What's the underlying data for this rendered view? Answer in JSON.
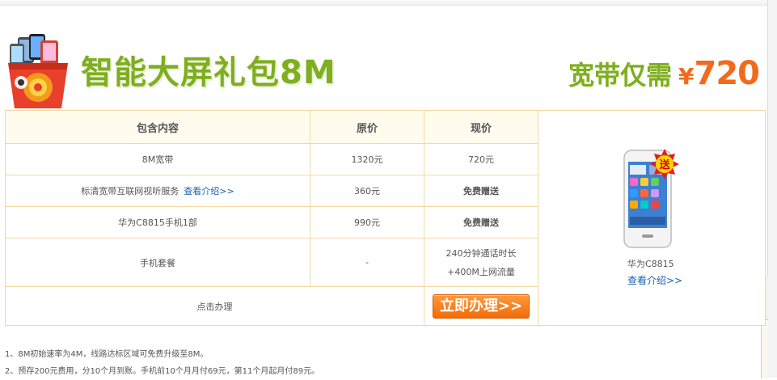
{
  "banner": {
    "title": "智能大屏礼包8M",
    "price_label": "宽带仅需",
    "price_currency": "¥",
    "price_value": "720",
    "title_color": "#7fae1f",
    "price_color": "#f26a1b"
  },
  "table": {
    "headers": [
      "包含内容",
      "原价",
      "现价"
    ],
    "rows": [
      {
        "item": "8M宽带",
        "original": "1320元",
        "current": "720元"
      },
      {
        "item": "标清宽带互联网视听服务",
        "link": "查看介绍>>",
        "original": "360元",
        "current": "免费赠送"
      },
      {
        "item": "华为C8815手机1部",
        "original": "990元",
        "current": "免费赠送"
      },
      {
        "item": "手机套餐",
        "original": "-",
        "current_line1": "240分钟通话时长",
        "current_line2": "+400M上网流量"
      }
    ],
    "action_label": "点击办理",
    "button_label": "立即办理>>"
  },
  "phone": {
    "caption": "华为C8815",
    "link": "查看介绍>>",
    "badge": "送",
    "icon": "phone-image"
  },
  "notes": [
    "1、8M初始速率为4M，线路达标区域可免费升级至8M。",
    "2、预存200元费用，分10个月到账。手机前10个月月付69元，第11个月起月付89元。"
  ]
}
